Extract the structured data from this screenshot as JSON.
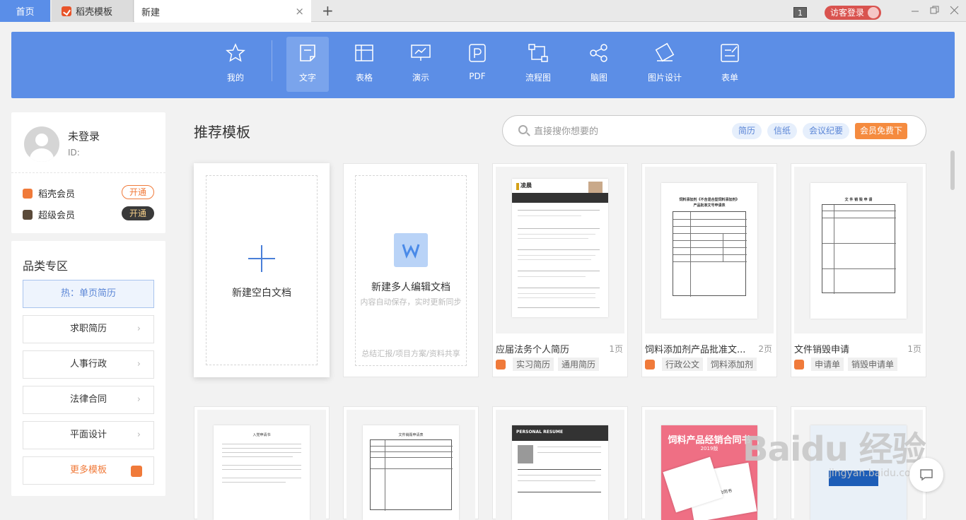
{
  "tabs": {
    "home": "首页",
    "daoke": "稻壳模板",
    "new": "新建",
    "close": "×",
    "add": "+"
  },
  "window": {
    "count": "1",
    "login": "访客登录"
  },
  "ribbon": [
    {
      "label": "我的",
      "icon": "star-icon"
    },
    {
      "label": "文字",
      "icon": "document-icon",
      "active": true
    },
    {
      "label": "表格",
      "icon": "table-icon"
    },
    {
      "label": "演示",
      "icon": "presentation-icon"
    },
    {
      "label": "PDF",
      "icon": "pdf-icon"
    },
    {
      "label": "流程图",
      "icon": "flowchart-icon"
    },
    {
      "label": "脑图",
      "icon": "mindmap-icon"
    },
    {
      "label": "图片设计",
      "icon": "image-design-icon"
    },
    {
      "label": "表单",
      "icon": "form-icon"
    }
  ],
  "user": {
    "name": "未登录",
    "id_label": "ID:",
    "memberships": [
      {
        "label": "稻壳会员",
        "action": "开通",
        "color": "#f07a3a"
      },
      {
        "label": "超级会员",
        "action": "开通",
        "color": "#5a4a3a"
      }
    ]
  },
  "categories": {
    "title": "品类专区",
    "hot": "热：单页简历",
    "items": [
      "求职简历",
      "人事行政",
      "法律合同",
      "平面设计"
    ],
    "more": "更多模板"
  },
  "main": {
    "title": "推荐模板"
  },
  "search": {
    "placeholder": "直接搜你想要的",
    "chips": [
      "简历",
      "信纸",
      "会议纪要"
    ],
    "vip": "会员免费下"
  },
  "blank": {
    "label": "新建空白文档"
  },
  "collab": {
    "label": "新建多人编辑文档",
    "sub": "内容自动保存，实时更新同步",
    "footer": "总结汇报/项目方案/资料共享"
  },
  "templates": [
    {
      "title": "应届法务个人简历",
      "pages": "1页",
      "tags": [
        "实习简历",
        "通用简历"
      ]
    },
    {
      "title": "饲料添加剂产品批准文...",
      "pages": "2页",
      "tags": [
        "行政公文",
        "饲料添加剂"
      ]
    },
    {
      "title": "文件销毁申请",
      "pages": "1页",
      "tags": [
        "申请单",
        "销毁申请单"
      ]
    }
  ],
  "thumbs": {
    "resume_name": "凌晨",
    "approval_title": "饲料添加剂《不含混合型饲料添加剂》",
    "approval_sub": "产品批准文号申请表",
    "destroy_title": "文 件 销 毁 申 请",
    "row2_a": "入党申请书",
    "row2_b": "文件销毁申请表",
    "row2_c": "PERSONAL RESUME",
    "row2_d": "饲料产品经销合同书",
    "row2_d_year": "2019版",
    "row2_d_paper": "饲料产品经销合同书"
  },
  "watermark": {
    "logo": "Baidu 经验",
    "url": "jingyan.baidu.com"
  }
}
